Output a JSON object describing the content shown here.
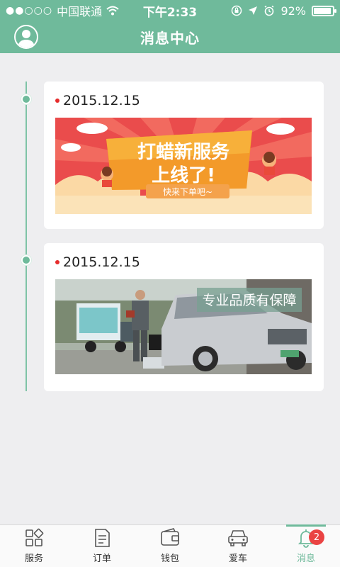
{
  "status_bar": {
    "signal_dots": "●●○○○",
    "carrier": "中国联通",
    "time": "下午2:33",
    "battery_percent_text": "92%",
    "battery_level": 0.92
  },
  "header": {
    "title": "消息中心"
  },
  "messages": [
    {
      "date": "2015.12.15",
      "banner": {
        "headline_line1": "打蜡新服务",
        "headline_line2": "上线了!",
        "subline": "快来下单吧~"
      }
    },
    {
      "date": "2015.12.15",
      "banner": {
        "caption": "专业品质有保障"
      }
    }
  ],
  "tab_bar": {
    "items": [
      {
        "label": "服务",
        "icon": "grid-icon"
      },
      {
        "label": "订单",
        "icon": "document-icon"
      },
      {
        "label": "钱包",
        "icon": "wallet-icon"
      },
      {
        "label": "爱车",
        "icon": "car-icon"
      },
      {
        "label": "消息",
        "icon": "bell-icon",
        "badge": "2",
        "active": true
      }
    ]
  },
  "colors": {
    "accent": "#6fba9b",
    "badge": "#ea4343",
    "background": "#eeeef0"
  }
}
